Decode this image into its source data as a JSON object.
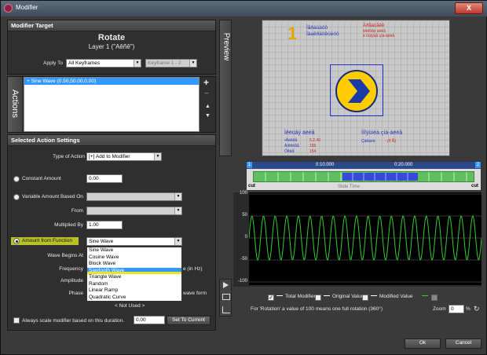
{
  "window": {
    "title": "Modifier",
    "close_label": "X"
  },
  "modifier_target": {
    "header": "Modifier Target",
    "name": "Rotate",
    "layer": "Layer 1 (\"Aêñê\")",
    "apply_to_label": "Apply To",
    "apply_to_value": "All Keyframes",
    "keyframe_value": "Keyframe 1 - 2"
  },
  "actions": {
    "tab_label": "Actions",
    "items": [
      "+ Sine Wave (0.50,50.00,0.00)"
    ],
    "add_label": "+",
    "remove_label": "−",
    "up_label": "▲",
    "down_label": "▼"
  },
  "settings": {
    "header": "Selected Action Settings",
    "type_label": "Type of Action",
    "type_value": "[+] Add to Modifier",
    "constant_label": "Constant Amount",
    "constant_value": "0.00",
    "variable_label": "Variable Amount Based On",
    "from_label": "From",
    "multiplied_label": "Multiplied By",
    "multiplied_value": "1.00",
    "function_label": "Amount from Function",
    "function_value": "Sine Wave",
    "wave_begins_label": "Wave Begins At",
    "frequency_label": "Frequency",
    "frequency_suffix": "e (in Hz)",
    "amplitude_label": "Amplitude",
    "phase_label": "Phase",
    "phase_suffix": "wave form",
    "not_used": "< Not Used >",
    "function_options": [
      "Sine Wave",
      "Cosine Wave",
      "Block Wave",
      "Sawtooth Wave",
      "Triangle Wave",
      "Random",
      "Linear Ramp",
      "Quadratic Curve"
    ],
    "highlighted_option": "Sawtooth Wave",
    "always_scale_label": "Always scale modifier based on this duration.",
    "always_scale_value": "0.00",
    "set_current_label": "Set To Current"
  },
  "preview": {
    "tab_label": "Preview",
    "slide_number": "1",
    "text_top_left": [
      "Ìåðàüàôô",
      "Ìàaêðàìíêüèóô"
    ],
    "text_top_right": [
      "Àðåàüåêê",
      "ëêêðåý äëèå",
      "ë íìüíÿüå çíà-àëèå"
    ],
    "text_bottom_left_title": "Ìêëüåý äëèå",
    "text_bottom_left_rows": [
      "•Àëêêå",
      "Àíêêëåå",
      "Óêàå"
    ],
    "text_bottom_left_vals": [
      "5.2.40",
      "155",
      "154"
    ],
    "text_bottom_right_title": "Ìíîýüìèà çíà-àëèå",
    "text_bottom_right_sub": "Çàêàèà",
    "text_bottom_right_val": "- (ñ Ñ)"
  },
  "timeline": {
    "start_marker": "1",
    "end_marker": "2",
    "t1": "0:10.000",
    "t2": "0:20.000",
    "cut_left": "cut",
    "cut_right": "cut",
    "slide_time_label": "Slide Time"
  },
  "graph": {
    "y_ticks": [
      "100",
      "50",
      "0",
      "-50",
      "-100"
    ],
    "legend_total": "Total Modifier",
    "legend_original": "Original Value",
    "legend_modified": "Modified Value",
    "line_color": "#33cc33",
    "info_text": "For 'Rotation' a value of 100 means one full rotation (360°)",
    "zoom_label": "Zoom",
    "zoom_value": "0",
    "zoom_unit": "%"
  },
  "buttons": {
    "ok": "Ok",
    "cancel": "Cancel"
  }
}
